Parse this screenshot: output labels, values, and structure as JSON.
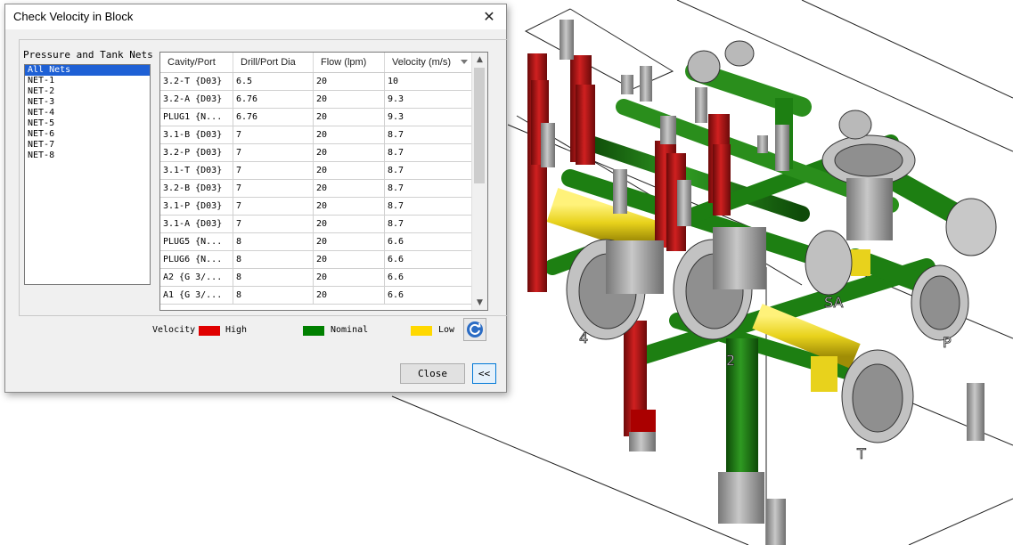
{
  "dialog": {
    "title": "Check Velocity in Block",
    "close_glyph": "✕"
  },
  "nets": {
    "label": "Pressure and Tank Nets",
    "items": [
      "All Nets",
      "NET-1",
      "NET-2",
      "NET-3",
      "NET-4",
      "NET-5",
      "NET-6",
      "NET-7",
      "NET-8"
    ],
    "selected": "All Nets"
  },
  "table": {
    "columns": [
      "Cavity/Port",
      "Drill/Port Dia",
      "Flow (lpm)",
      "Velocity (m/s)"
    ],
    "rows": [
      [
        "3.2-T  {D03}",
        "6.5",
        "20",
        "10"
      ],
      [
        "3.2-A  {D03}",
        "6.76",
        "20",
        "9.3"
      ],
      [
        "PLUG1  {N...",
        "6.76",
        "20",
        "9.3"
      ],
      [
        "3.1-B  {D03}",
        "7",
        "20",
        "8.7"
      ],
      [
        "3.2-P  {D03}",
        "7",
        "20",
        "8.7"
      ],
      [
        "3.1-T  {D03}",
        "7",
        "20",
        "8.7"
      ],
      [
        "3.2-B  {D03}",
        "7",
        "20",
        "8.7"
      ],
      [
        "3.1-P  {D03}",
        "7",
        "20",
        "8.7"
      ],
      [
        "3.1-A  {D03}",
        "7",
        "20",
        "8.7"
      ],
      [
        "PLUG5  {N...",
        "8",
        "20",
        "6.6"
      ],
      [
        "PLUG6  {N...",
        "8",
        "20",
        "6.6"
      ],
      [
        "A2  {G 3/...",
        "8",
        "20",
        "6.6"
      ],
      [
        "A1  {G 3/...",
        "8",
        "20",
        "6.6"
      ]
    ]
  },
  "legend": {
    "title": "Velocity",
    "high": "High",
    "nominal": "Nominal",
    "low": "Low",
    "high_color": "#e00000",
    "nominal_color": "#008000",
    "low_color": "#ffd800"
  },
  "buttons": {
    "close": "Close",
    "collapse": "<<",
    "refresh_icon": "refresh-icon"
  },
  "model": {
    "labels": [
      "4",
      "2",
      "SA",
      "P",
      "T"
    ]
  },
  "colors": {
    "pipe_green": "#1d7f12",
    "pipe_red": "#b21010",
    "pipe_yellow": "#e8d21c",
    "port_gray": "#bdbdbd"
  }
}
